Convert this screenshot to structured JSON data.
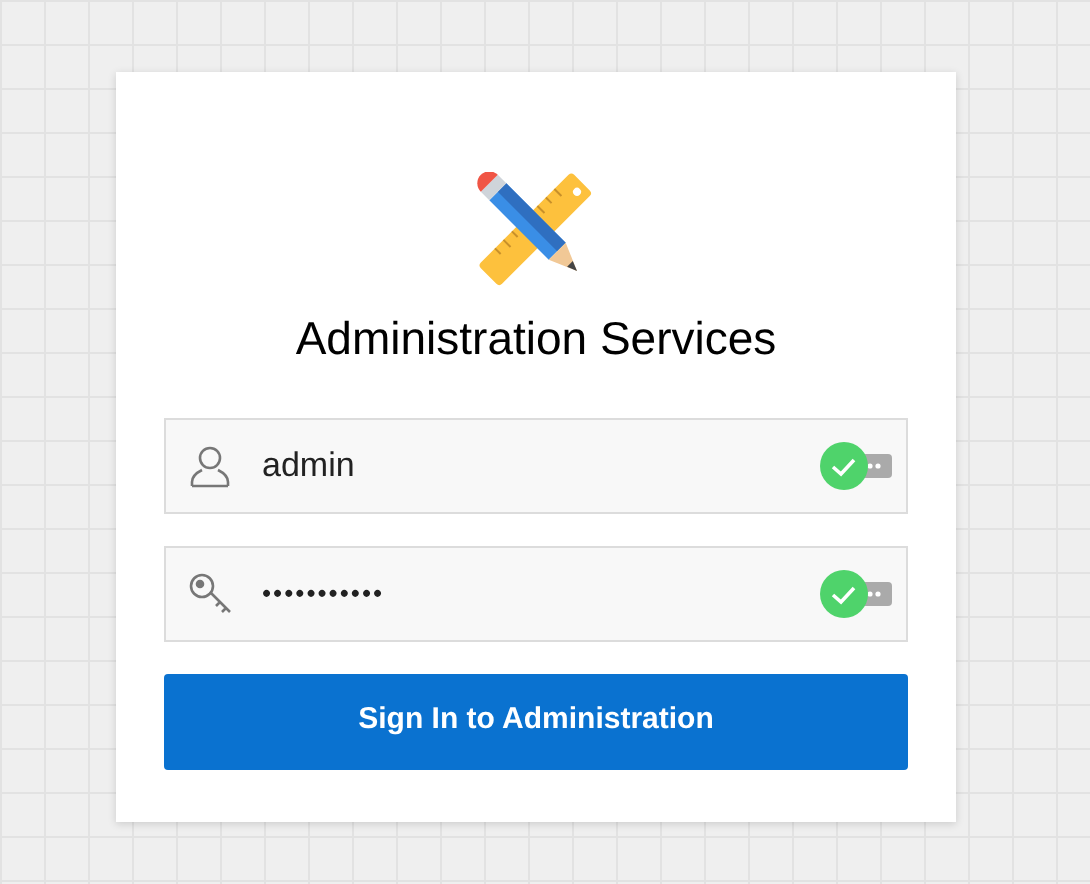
{
  "title": "Administration Services",
  "fields": [
    {
      "kind": "username",
      "value": "admin",
      "valid": true
    },
    {
      "kind": "password",
      "value": "•••••••••••",
      "valid": true
    }
  ],
  "button": "Sign In to Administration"
}
